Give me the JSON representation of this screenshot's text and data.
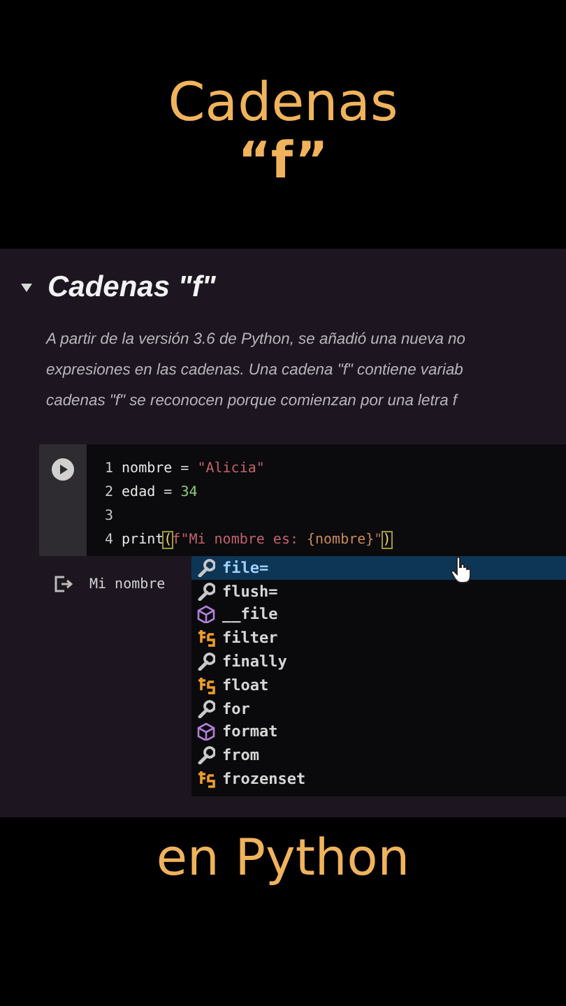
{
  "video_title": {
    "line_1": "Cadenas",
    "line_2": "“f”"
  },
  "section": {
    "expanded": true,
    "title": "Cadenas \"f\"",
    "paragraph_lines": [
      "A partir de la versión 3.6 de Python, se añadió una nueva no",
      "expresiones en las cadenas. Una cadena \"f\" contiene variab",
      "cadenas \"f\" se reconocen porque comienzan por una letra f"
    ]
  },
  "code_cell": {
    "lines": [
      {
        "number": "1",
        "tokens": [
          {
            "text": "nombre = ",
            "kind": "plain"
          },
          {
            "text": "\"Alicia\"",
            "kind": "string"
          }
        ]
      },
      {
        "number": "2",
        "tokens": [
          {
            "text": "edad = ",
            "kind": "plain"
          },
          {
            "text": "34",
            "kind": "number"
          }
        ]
      },
      {
        "number": "3"
      },
      {
        "number": "4",
        "tokens": [
          {
            "text": "print",
            "kind": "plain"
          },
          {
            "text": "(",
            "kind": "bracket"
          },
          {
            "text": "f\"Mi nombre es: ",
            "kind": "string"
          },
          {
            "text": "{nombre}",
            "kind": "brace"
          },
          {
            "text": "\"",
            "kind": "string"
          },
          {
            "text": ")",
            "kind": "bracket"
          }
        ]
      }
    ],
    "output": "Mi nombre"
  },
  "autocomplete": {
    "items": [
      {
        "label": "file=",
        "kind": "keyword",
        "selected": true
      },
      {
        "label": "flush=",
        "kind": "keyword",
        "selected": false
      },
      {
        "label": "__file",
        "kind": "variable",
        "selected": false
      },
      {
        "label": "filter",
        "kind": "function",
        "selected": false
      },
      {
        "label": "finally",
        "kind": "keyword",
        "selected": false
      },
      {
        "label": "float",
        "kind": "function",
        "selected": false
      },
      {
        "label": "for",
        "kind": "keyword",
        "selected": false
      },
      {
        "label": "format",
        "kind": "variable",
        "selected": false
      },
      {
        "label": "from",
        "kind": "keyword",
        "selected": false
      },
      {
        "label": "frozenset",
        "kind": "function",
        "selected": false
      }
    ]
  },
  "caption": "en Python"
}
